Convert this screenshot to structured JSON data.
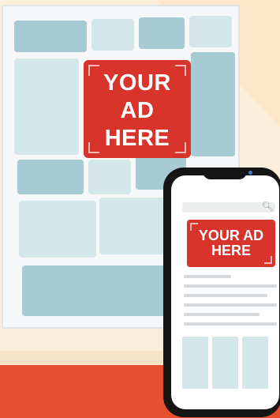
{
  "poster": {
    "ad_lines": [
      "YOUR",
      "AD",
      "HERE"
    ]
  },
  "phone": {
    "ad_lines": [
      "YOUR AD",
      "HERE"
    ],
    "search_icon": "search-icon"
  },
  "colors": {
    "wall": "#fbefdc",
    "floor": "#e5512f",
    "ad_red": "#d8342b",
    "tile_teal": "#a6cbd3",
    "tile_light": "#d3e6ea",
    "phone_body": "#151515"
  }
}
